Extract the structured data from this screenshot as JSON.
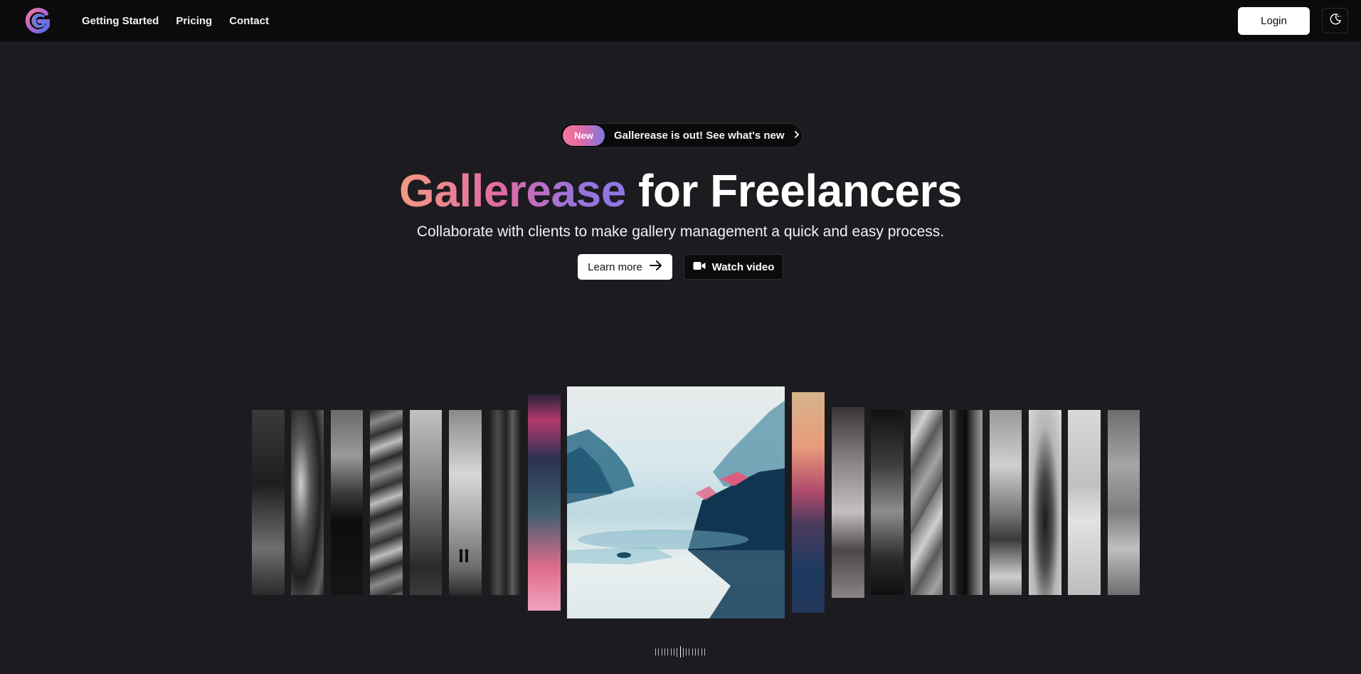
{
  "nav": {
    "logo_letter": "G",
    "links": [
      "Getting Started",
      "Pricing",
      "Contact"
    ],
    "login_label": "Login"
  },
  "hero": {
    "announcement": {
      "badge": "New",
      "text": "Gallerease is out! See what's new"
    },
    "headline_brand": "Gallerease",
    "headline_rest": "for Freelancers",
    "subtitle": "Collaborate with clients to make gallery management a quick and easy process.",
    "learn_more_label": "Learn more",
    "watch_video_label": "Watch video"
  },
  "gallery": {
    "strip_count": 21,
    "featured_index": 8
  },
  "colors": {
    "background": "#1c1b20",
    "nav_background": "#0b0b0c",
    "brand_gradient_start": "#f39a82",
    "brand_gradient_end": "#8a78e6"
  },
  "icons": {
    "theme_toggle": "moon-sun-icon",
    "announcement_chevron": "chevron-right-icon",
    "learn_more": "arrow-right-icon",
    "watch_video": "video-camera-icon"
  }
}
